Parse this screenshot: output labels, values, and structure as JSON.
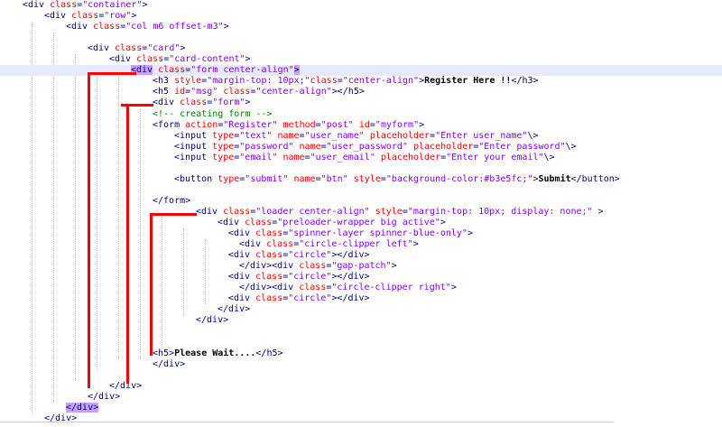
{
  "code_lines": [
    {
      "segments": [
        {
          "k": "t",
          "s": "<div "
        },
        {
          "k": "a",
          "s": "class"
        },
        {
          "k": "t",
          "s": "="
        },
        {
          "k": "v",
          "s": "\"container\""
        },
        {
          "k": "t",
          "s": ">"
        }
      ]
    },
    {
      "segments": [
        {
          "k": "t",
          "s": "<div "
        },
        {
          "k": "a",
          "s": "class"
        },
        {
          "k": "t",
          "s": "="
        },
        {
          "k": "v",
          "s": "\"row\""
        },
        {
          "k": "t",
          "s": ">"
        }
      ]
    },
    {
      "segments": [
        {
          "k": "t",
          "s": "<div "
        },
        {
          "k": "a",
          "s": "class"
        },
        {
          "k": "t",
          "s": "="
        },
        {
          "k": "v",
          "s": "\"col m6 offset-m3\""
        },
        {
          "k": "t",
          "s": ">"
        }
      ]
    },
    {
      "segments": []
    },
    {
      "segments": [
        {
          "k": "t",
          "s": "<div "
        },
        {
          "k": "a",
          "s": "class"
        },
        {
          "k": "t",
          "s": "="
        },
        {
          "k": "v",
          "s": "\"card\""
        },
        {
          "k": "t",
          "s": ">"
        }
      ]
    },
    {
      "segments": [
        {
          "k": "t",
          "s": "<div "
        },
        {
          "k": "a",
          "s": "class"
        },
        {
          "k": "t",
          "s": "="
        },
        {
          "k": "v",
          "s": "\"card-content\""
        },
        {
          "k": "t",
          "s": ">"
        }
      ]
    },
    {
      "segments": [
        {
          "k": "t",
          "s": "<div",
          "hl": true
        },
        {
          "k": "t",
          "s": " "
        },
        {
          "k": "a",
          "s": "class"
        },
        {
          "k": "t",
          "s": "="
        },
        {
          "k": "v",
          "s": "\"form center-align\""
        },
        {
          "k": "t",
          "s": ">",
          "hl": true
        }
      ]
    },
    {
      "segments": [
        {
          "k": "t",
          "s": "<h3 "
        },
        {
          "k": "a",
          "s": "style"
        },
        {
          "k": "t",
          "s": "="
        },
        {
          "k": "v",
          "s": "\"margin-top: 10px;\""
        },
        {
          "k": "a",
          "s": "class"
        },
        {
          "k": "t",
          "s": "="
        },
        {
          "k": "v",
          "s": "\"center-align\""
        },
        {
          "k": "t",
          "s": ">"
        },
        {
          "k": "x",
          "s": "Register Here !!"
        },
        {
          "k": "t",
          "s": "</h3>"
        }
      ]
    },
    {
      "segments": [
        {
          "k": "t",
          "s": "<h5 "
        },
        {
          "k": "a",
          "s": "id"
        },
        {
          "k": "t",
          "s": "="
        },
        {
          "k": "v",
          "s": "\"msg\""
        },
        {
          "k": "t",
          "s": " "
        },
        {
          "k": "a",
          "s": "class"
        },
        {
          "k": "t",
          "s": "="
        },
        {
          "k": "v",
          "s": "\"center-align\""
        },
        {
          "k": "t",
          "s": "></h5>"
        }
      ]
    },
    {
      "segments": [
        {
          "k": "t",
          "s": "<div "
        },
        {
          "k": "a",
          "s": "class"
        },
        {
          "k": "t",
          "s": "="
        },
        {
          "k": "v",
          "s": "\"form\""
        },
        {
          "k": "t",
          "s": ">"
        }
      ]
    },
    {
      "segments": [
        {
          "k": "c",
          "s": "<!-- creating form -->"
        }
      ]
    },
    {
      "segments": [
        {
          "k": "t",
          "s": "<form "
        },
        {
          "k": "a",
          "s": "action"
        },
        {
          "k": "t",
          "s": "="
        },
        {
          "k": "v",
          "s": "\"Register\""
        },
        {
          "k": "t",
          "s": " "
        },
        {
          "k": "a",
          "s": "method"
        },
        {
          "k": "t",
          "s": "="
        },
        {
          "k": "v",
          "s": "\"post\""
        },
        {
          "k": "t",
          "s": " "
        },
        {
          "k": "a",
          "s": "id"
        },
        {
          "k": "t",
          "s": "="
        },
        {
          "k": "v",
          "s": "\"myform\""
        },
        {
          "k": "t",
          "s": ">"
        }
      ]
    },
    {
      "segments": [
        {
          "k": "t",
          "s": "<input "
        },
        {
          "k": "a",
          "s": "type"
        },
        {
          "k": "t",
          "s": "="
        },
        {
          "k": "v",
          "s": "\"text\""
        },
        {
          "k": "t",
          "s": " "
        },
        {
          "k": "a",
          "s": "name"
        },
        {
          "k": "t",
          "s": "="
        },
        {
          "k": "v",
          "s": "\"user_name\""
        },
        {
          "k": "t",
          "s": " "
        },
        {
          "k": "a",
          "s": "placeholder"
        },
        {
          "k": "t",
          "s": "="
        },
        {
          "k": "v",
          "s": "\"Enter user_name\""
        },
        {
          "k": "t",
          "s": "\\>"
        }
      ]
    },
    {
      "segments": [
        {
          "k": "t",
          "s": "<input "
        },
        {
          "k": "a",
          "s": "type"
        },
        {
          "k": "t",
          "s": "="
        },
        {
          "k": "v",
          "s": "\"password\""
        },
        {
          "k": "t",
          "s": " "
        },
        {
          "k": "a",
          "s": "name"
        },
        {
          "k": "t",
          "s": "="
        },
        {
          "k": "v",
          "s": "\"user_password\""
        },
        {
          "k": "t",
          "s": " "
        },
        {
          "k": "a",
          "s": "placeholder"
        },
        {
          "k": "t",
          "s": "="
        },
        {
          "k": "v",
          "s": "\"Enter password\""
        },
        {
          "k": "t",
          "s": "\\>"
        }
      ]
    },
    {
      "segments": [
        {
          "k": "t",
          "s": "<input "
        },
        {
          "k": "a",
          "s": "type"
        },
        {
          "k": "t",
          "s": "="
        },
        {
          "k": "v",
          "s": "\"email\""
        },
        {
          "k": "t",
          "s": " "
        },
        {
          "k": "a",
          "s": "name"
        },
        {
          "k": "t",
          "s": "="
        },
        {
          "k": "v",
          "s": "\"user_email\""
        },
        {
          "k": "t",
          "s": " "
        },
        {
          "k": "a",
          "s": "placeholder"
        },
        {
          "k": "t",
          "s": "="
        },
        {
          "k": "v",
          "s": "\"Enter your email\""
        },
        {
          "k": "t",
          "s": "\\>"
        }
      ]
    },
    {
      "segments": []
    },
    {
      "segments": [
        {
          "k": "t",
          "s": "<button "
        },
        {
          "k": "a",
          "s": "type"
        },
        {
          "k": "t",
          "s": "="
        },
        {
          "k": "v",
          "s": "\"submit\""
        },
        {
          "k": "t",
          "s": " "
        },
        {
          "k": "a",
          "s": "name"
        },
        {
          "k": "t",
          "s": "="
        },
        {
          "k": "v",
          "s": "\"btn\""
        },
        {
          "k": "t",
          "s": " "
        },
        {
          "k": "a",
          "s": "style"
        },
        {
          "k": "t",
          "s": "="
        },
        {
          "k": "v",
          "s": "\"background-color:#b3e5fc;\""
        },
        {
          "k": "t",
          "s": ">"
        },
        {
          "k": "x",
          "s": "Submit"
        },
        {
          "k": "t",
          "s": "</button>"
        }
      ]
    },
    {
      "segments": []
    },
    {
      "segments": [
        {
          "k": "t",
          "s": "</form>"
        }
      ]
    },
    {
      "segments": [
        {
          "k": "t",
          "s": "<div "
        },
        {
          "k": "a",
          "s": "class"
        },
        {
          "k": "t",
          "s": "="
        },
        {
          "k": "v",
          "s": "\"loader center-align\""
        },
        {
          "k": "t",
          "s": " "
        },
        {
          "k": "a",
          "s": "style"
        },
        {
          "k": "t",
          "s": "="
        },
        {
          "k": "v",
          "s": "\"margin-top: 10px; display: none;\""
        },
        {
          "k": "t",
          "s": " >"
        }
      ]
    },
    {
      "segments": [
        {
          "k": "t",
          "s": "<div "
        },
        {
          "k": "a",
          "s": "class"
        },
        {
          "k": "t",
          "s": "="
        },
        {
          "k": "v",
          "s": "\"preloader-wrapper big active\""
        },
        {
          "k": "t",
          "s": ">"
        }
      ]
    },
    {
      "segments": [
        {
          "k": "t",
          "s": "<div "
        },
        {
          "k": "a",
          "s": "class"
        },
        {
          "k": "t",
          "s": "="
        },
        {
          "k": "v",
          "s": "\"spinner-layer spinner-blue-only\""
        },
        {
          "k": "t",
          "s": ">"
        }
      ]
    },
    {
      "segments": [
        {
          "k": "t",
          "s": "<div "
        },
        {
          "k": "a",
          "s": "class"
        },
        {
          "k": "t",
          "s": "="
        },
        {
          "k": "v",
          "s": "\"circle-clipper left\""
        },
        {
          "k": "t",
          "s": ">"
        }
      ]
    },
    {
      "segments": [
        {
          "k": "t",
          "s": "<div "
        },
        {
          "k": "a",
          "s": "class"
        },
        {
          "k": "t",
          "s": "="
        },
        {
          "k": "v",
          "s": "\"circle\""
        },
        {
          "k": "t",
          "s": "></div>"
        }
      ]
    },
    {
      "segments": [
        {
          "k": "t",
          "s": "</div><div "
        },
        {
          "k": "a",
          "s": "class"
        },
        {
          "k": "t",
          "s": "="
        },
        {
          "k": "v",
          "s": "\"gap-patch\""
        },
        {
          "k": "t",
          "s": ">"
        }
      ]
    },
    {
      "segments": [
        {
          "k": "t",
          "s": "<div "
        },
        {
          "k": "a",
          "s": "class"
        },
        {
          "k": "t",
          "s": "="
        },
        {
          "k": "v",
          "s": "\"circle\""
        },
        {
          "k": "t",
          "s": "></div>"
        }
      ]
    },
    {
      "segments": [
        {
          "k": "t",
          "s": "</div><div "
        },
        {
          "k": "a",
          "s": "class"
        },
        {
          "k": "t",
          "s": "="
        },
        {
          "k": "v",
          "s": "\"circle-clipper right\""
        },
        {
          "k": "t",
          "s": ">"
        }
      ]
    },
    {
      "segments": [
        {
          "k": "t",
          "s": "<div "
        },
        {
          "k": "a",
          "s": "class"
        },
        {
          "k": "t",
          "s": "="
        },
        {
          "k": "v",
          "s": "\"circle\""
        },
        {
          "k": "t",
          "s": "></div>"
        }
      ]
    },
    {
      "segments": [
        {
          "k": "t",
          "s": "</div>"
        }
      ]
    },
    {
      "segments": [
        {
          "k": "t",
          "s": "</div>"
        }
      ]
    },
    {
      "segments": []
    },
    {
      "segments": []
    },
    {
      "segments": [
        {
          "k": "t",
          "s": "<h5>"
        },
        {
          "k": "x",
          "s": "Please Wait...."
        },
        {
          "k": "t",
          "s": "</h5>"
        }
      ]
    },
    {
      "segments": [
        {
          "k": "t",
          "s": "</div>"
        }
      ]
    },
    {
      "segments": []
    },
    {
      "segments": [
        {
          "k": "t",
          "s": "</div>"
        }
      ]
    },
    {
      "segments": [
        {
          "k": "t",
          "s": "</div>"
        }
      ]
    },
    {
      "segments": [
        {
          "k": "t",
          "s": "</div>",
          "hl": true
        }
      ]
    },
    {
      "segments": [
        {
          "k": "t",
          "s": "</div>"
        }
      ]
    }
  ],
  "colors": {
    "tag": "#000080",
    "attribute": "#ff0000",
    "value": "#8000ff",
    "text": "#000000",
    "comment": "#008000",
    "brace_highlight": "#c8a0ff",
    "current_line": "#e8e8ff",
    "annotation": "#ff0000"
  },
  "highlighted_line": 6
}
